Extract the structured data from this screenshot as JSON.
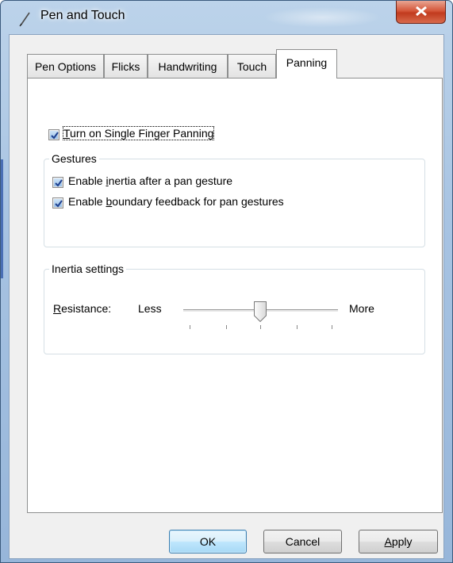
{
  "window": {
    "title": "Pen and Touch",
    "close_icon": "close-x-icon",
    "app_icon": "pen-icon"
  },
  "tabs": [
    {
      "label": "Pen Options",
      "active": false
    },
    {
      "label": "Flicks",
      "active": false
    },
    {
      "label": "Handwriting",
      "active": false
    },
    {
      "label": "Touch",
      "active": false
    },
    {
      "label": "Panning",
      "active": true
    }
  ],
  "panning": {
    "single_finger": {
      "checked": true,
      "label_pre": "",
      "label_u": "T",
      "label_post": "urn on Single Finger Panning"
    },
    "gestures": {
      "title": "Gestures",
      "inertia": {
        "checked": true,
        "label_pre": "Enable ",
        "label_u": "i",
        "label_post": "nertia after a pan gesture"
      },
      "boundary": {
        "checked": true,
        "label_pre": "Enable ",
        "label_u": "b",
        "label_post": "oundary feedback for pan gestures"
      }
    },
    "inertia_settings": {
      "title": "Inertia settings",
      "resistance_u": "R",
      "resistance_post": "esistance:",
      "less": "Less",
      "more": "More",
      "slider": {
        "position": 2,
        "min": 0,
        "max": 4
      }
    }
  },
  "buttons": {
    "ok": "OK",
    "cancel": "Cancel",
    "apply_u": "A",
    "apply_post": "pply"
  },
  "colors": {
    "accent": "#3c7fb1",
    "titlebar": "#a7c3e2",
    "close": "#c13b1e"
  }
}
